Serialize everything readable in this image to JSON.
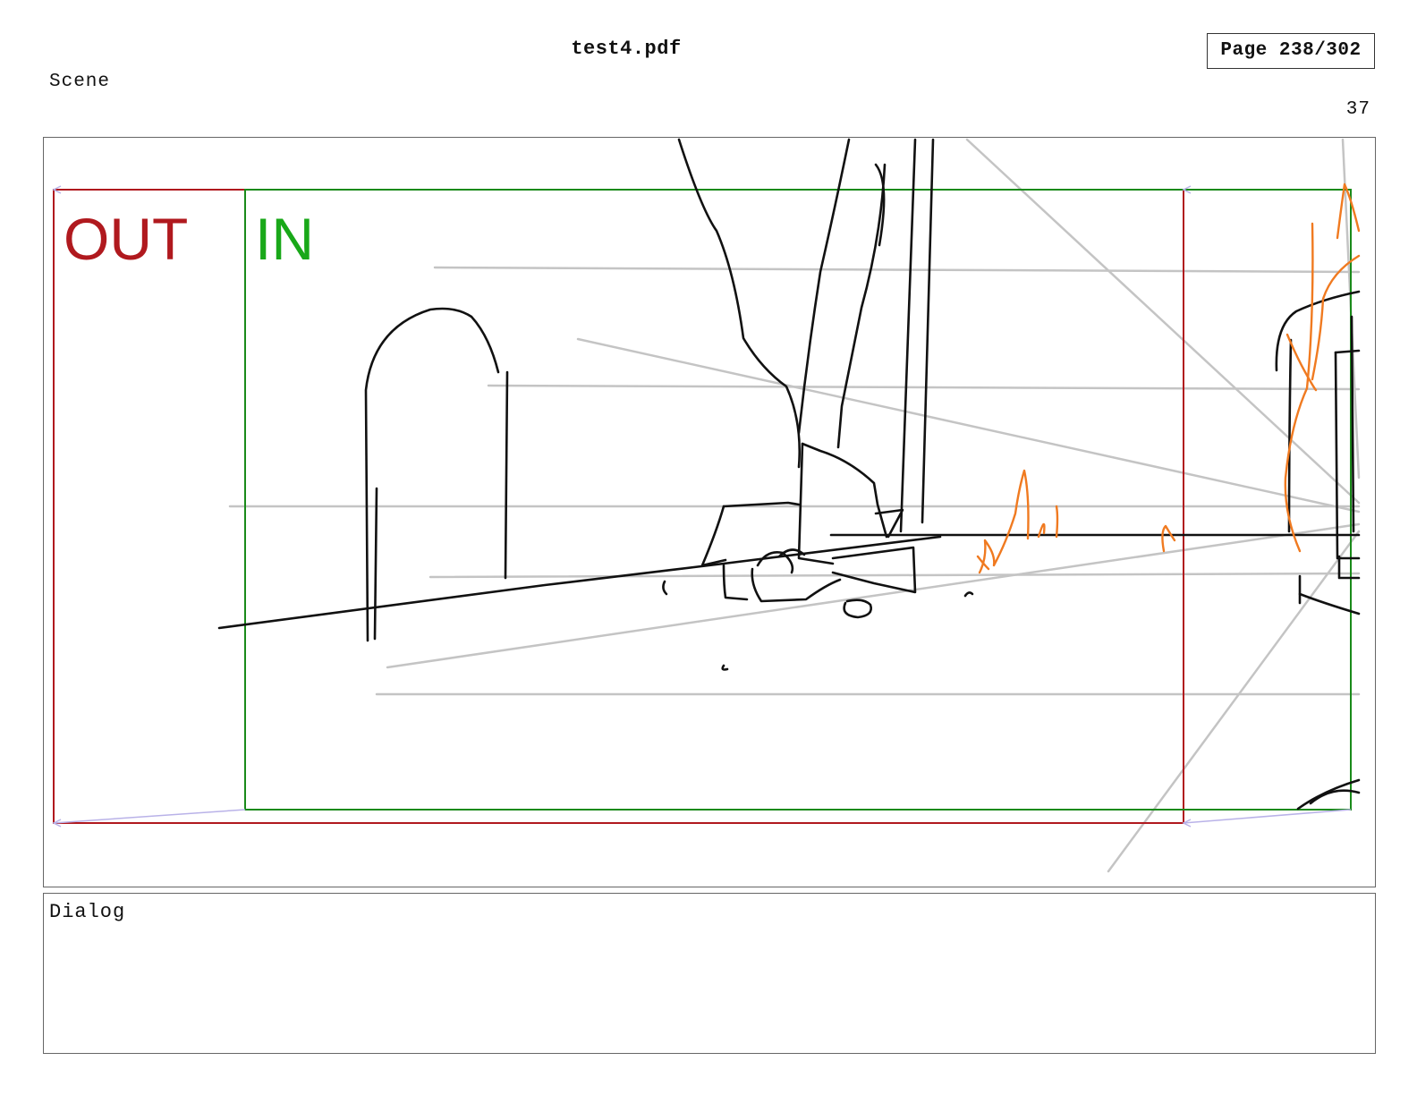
{
  "header": {
    "document_title": "test4.pdf",
    "page_indicator": "Page 238/302"
  },
  "scene": {
    "label": "Scene",
    "panel_number": "37"
  },
  "panel": {
    "out_label": "OUT",
    "in_label": "IN",
    "colors": {
      "out_frame": "#b0191e",
      "in_frame": "#1a8a1a",
      "in_label": "#19a819",
      "sketch_line": "#111111",
      "guide_line": "#c4c4c4",
      "fire": "#f07a20",
      "motion_path": "#b9b2e8"
    }
  },
  "dialog": {
    "label": "Dialog"
  }
}
